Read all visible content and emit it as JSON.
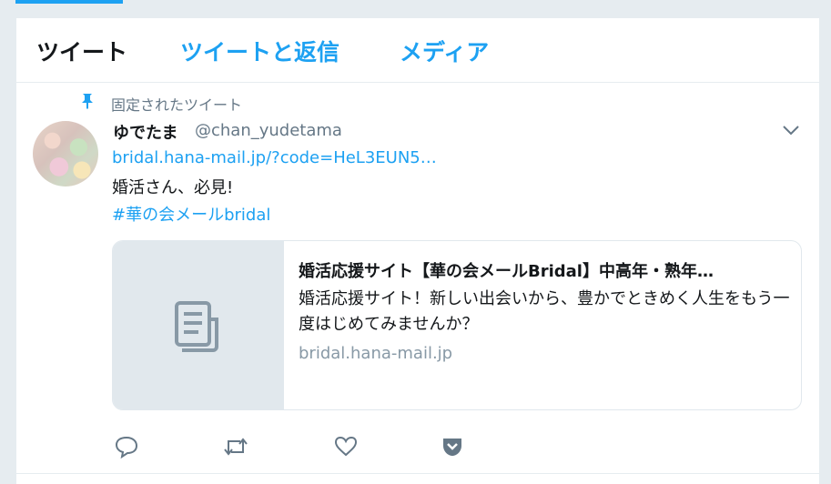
{
  "tabs": [
    {
      "label": "ツイート",
      "active": true
    },
    {
      "label": "ツイートと返信",
      "active": false
    },
    {
      "label": "メディア",
      "active": false
    }
  ],
  "pinned": {
    "label": "固定されたツイート",
    "icon": "pin-icon"
  },
  "tweet": {
    "name": "ゆでたま",
    "handle": "@chan_yudetama",
    "link": "bridal.hana-mail.jp/?code=HeL3EUN5…",
    "text": "婚活さん、必見!",
    "hashtag": "#華の会メールbridal"
  },
  "card": {
    "title": "婚活応援サイト【華の会メールBridal】中高年・熟年…",
    "description": "婚活応援サイト！新しい出会いから、豊かでときめく人生をもう一度はじめてみませんか？",
    "domain": "bridal.hana-mail.jp",
    "thumbnail_icon": "document-icon"
  },
  "actions": [
    "reply-icon",
    "retweet-icon",
    "like-icon",
    "pocket-icon"
  ],
  "colors": {
    "accent": "#1da1f2",
    "text": "#14171a",
    "muted": "#657786",
    "background": "#e6ecf0"
  }
}
